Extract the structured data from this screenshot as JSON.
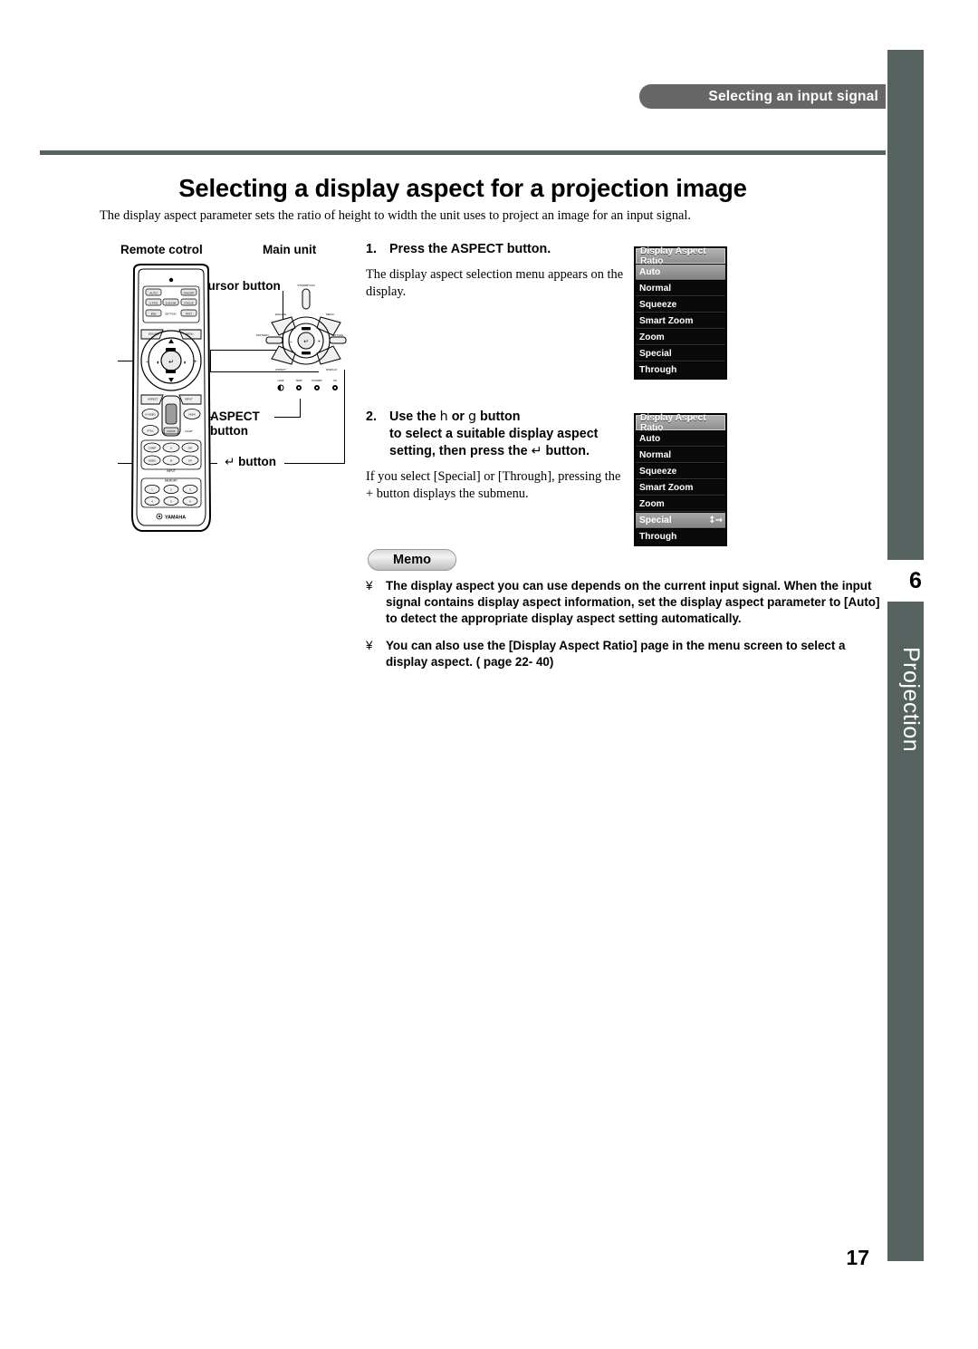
{
  "header": {
    "running_head": "Selecting an input signal"
  },
  "page": {
    "title": "Selecting a display aspect for a projection image",
    "intro": "The display aspect parameter sets the ratio of height to width the unit uses to project an image for an input signal.",
    "number": "17"
  },
  "figure": {
    "remote_label": "Remote cotrol",
    "main_unit_label": "Main unit",
    "callouts": {
      "cursor_button": "cursor button",
      "aspect_button_line1": "ASPECT",
      "aspect_button_line2": "button",
      "enter_button": "button",
      "enter_glyph": "↵"
    },
    "remote_buttons": {
      "top_row": [
        "AUTO",
        "ON/OFF"
      ],
      "row2": [
        "V. POS",
        "D.ZOOM",
        "FOCUS"
      ],
      "row3": [
        "IRIS",
        "SETTING",
        "PATT"
      ],
      "nav_side": [
        "ESCAPE",
        "MENU"
      ],
      "mid_row": [
        "ASPECT",
        "INPUT"
      ],
      "source_row1": [
        "S-VIDEO",
        "HDMI"
      ],
      "source_row2": [
        "STILL",
        "LIGHT"
      ],
      "inputs": [
        "COMP",
        "A",
        "DVI",
        "VIDEO",
        "B",
        "D4"
      ],
      "input_group_label": "INPUT",
      "memory_label": "MEMORY",
      "memory_keys": [
        "1",
        "2",
        "3",
        "4",
        "5",
        "6"
      ],
      "brand": "YAMAHA"
    },
    "main_unit_labels": {
      "standby": "STANDBY/ON",
      "escape": "ESCAPE",
      "menu": "MENU",
      "pattern": "PATTERN",
      "setting": "SETTING",
      "aspect": "ASPECT",
      "display": "DISPLAY",
      "indicators": [
        "LAMP",
        "TEMP",
        "STANDBY",
        "ON"
      ]
    }
  },
  "steps": [
    {
      "number": "1.",
      "heading": "Press the ASPECT button.",
      "body": "The display aspect selection menu appears on the display."
    },
    {
      "number": "2.",
      "heading_part1": "Use the",
      "heading_glyph_left": "h",
      "heading_or": "or",
      "heading_glyph_right": "g",
      "heading_part2": "button",
      "heading_line2": "to select a suitable display aspect",
      "heading_line3_pre": "setting, then press the",
      "heading_line3_glyph": "↵",
      "heading_line3_post": "button.",
      "body": "If you select [Special] or [Through], pressing the + button displays the submenu."
    }
  ],
  "osd_menus": [
    {
      "title": "Display Aspect Ratio",
      "items": [
        {
          "label": "Auto",
          "selected": true,
          "indicator": ""
        },
        {
          "label": "Normal",
          "selected": false,
          "indicator": ""
        },
        {
          "label": "Squeeze",
          "selected": false,
          "indicator": ""
        },
        {
          "label": "Smart Zoom",
          "selected": false,
          "indicator": ""
        },
        {
          "label": "Zoom",
          "selected": false,
          "indicator": ""
        },
        {
          "label": "Special",
          "selected": false,
          "indicator": ""
        },
        {
          "label": "Through",
          "selected": false,
          "indicator": ""
        }
      ]
    },
    {
      "title": "Display Aspect Ratio",
      "items": [
        {
          "label": "Auto",
          "selected": false,
          "indicator": ""
        },
        {
          "label": "Normal",
          "selected": false,
          "indicator": ""
        },
        {
          "label": "Squeeze",
          "selected": false,
          "indicator": ""
        },
        {
          "label": "Smart Zoom",
          "selected": false,
          "indicator": ""
        },
        {
          "label": "Zoom",
          "selected": false,
          "indicator": ""
        },
        {
          "label": "Special",
          "selected": true,
          "indicator": "↕→"
        },
        {
          "label": "Through",
          "selected": false,
          "indicator": ""
        }
      ]
    }
  ],
  "memo": {
    "label": "Memo",
    "bullet": "¥",
    "items": [
      "The display aspect you can use depends on the current input signal. When the input signal contains display aspect information, set the display aspect parameter to [Auto] to detect the appropriate display aspect setting automatically.",
      "You can also use the [Display Aspect Ratio] page in the menu screen to select a display aspect. (    page 22- 40)"
    ]
  },
  "side_tab": {
    "chapter_number": "6",
    "chapter_name": "Projection"
  },
  "colors": {
    "slate": "#56625f",
    "header_badge": "#666666",
    "osd_black": "#0a0a0a",
    "osd_highlight": "#9a9a9a"
  }
}
